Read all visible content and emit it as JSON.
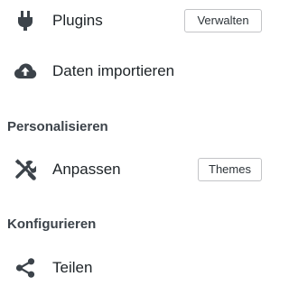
{
  "menu": {
    "plugins": {
      "label": "Plugins",
      "icon": "plug-icon",
      "action_label": "Verwalten"
    },
    "import": {
      "label": "Daten importieren",
      "icon": "cloud-upload-icon"
    },
    "personalize_heading": "Personalisieren",
    "customize": {
      "label": "Anpassen",
      "icon": "tools-icon",
      "action_label": "Themes"
    },
    "configure_heading": "Konfigurieren",
    "share": {
      "label": "Teilen",
      "icon": "share-icon"
    }
  },
  "colors": {
    "icon": "#3c434a",
    "text": "#1d2327",
    "button_border": "#c3c4c7"
  }
}
